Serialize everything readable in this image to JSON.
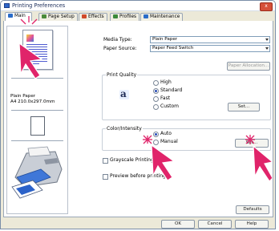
{
  "window": {
    "title": "Printing Preferences",
    "close_label": "x"
  },
  "tabs": [
    {
      "label": "Main",
      "icon": "main-icon",
      "color": "#2a6cc9",
      "active": true
    },
    {
      "label": "Page Setup",
      "icon": "page-setup-icon",
      "color": "#4a8a3a",
      "active": false
    },
    {
      "label": "Effects",
      "icon": "effects-icon",
      "color": "#d04a2a",
      "active": false
    },
    {
      "label": "Profiles",
      "icon": "profiles-icon",
      "color": "#3b8a3a",
      "active": false
    },
    {
      "label": "Maintenance",
      "icon": "maintenance-icon",
      "color": "#2a6cc9",
      "active": false
    }
  ],
  "preview": {
    "media_name": "Plain Paper",
    "paper_size": "A4 210.0x297.0mm"
  },
  "main": {
    "media_type_label": "Media Type:",
    "media_type_value": "Plain Paper",
    "paper_source_label": "Paper Source:",
    "paper_source_value": "Paper Feed Switch",
    "paper_allocation_label": "Paper Allocation...",
    "print_quality_label": "Print Quality",
    "quality_options": [
      "High",
      "Standard",
      "Fast",
      "Custom"
    ],
    "quality_selected": "Standard",
    "set_label": "Set...",
    "color_intensity_label": "Color/Intensity",
    "color_options": [
      "Auto",
      "Manual"
    ],
    "color_selected": "Auto",
    "color_set_label": "Set...",
    "grayscale_label": "Grayscale Printing",
    "preview_label": "Preview before printing",
    "defaults_label": "Defaults"
  },
  "footer": {
    "ok_label": "OK",
    "cancel_label": "Cancel",
    "help_label": "Help"
  },
  "colors": {
    "accent": "#2a4fb8",
    "highlight_arrow": "#e0246a"
  }
}
